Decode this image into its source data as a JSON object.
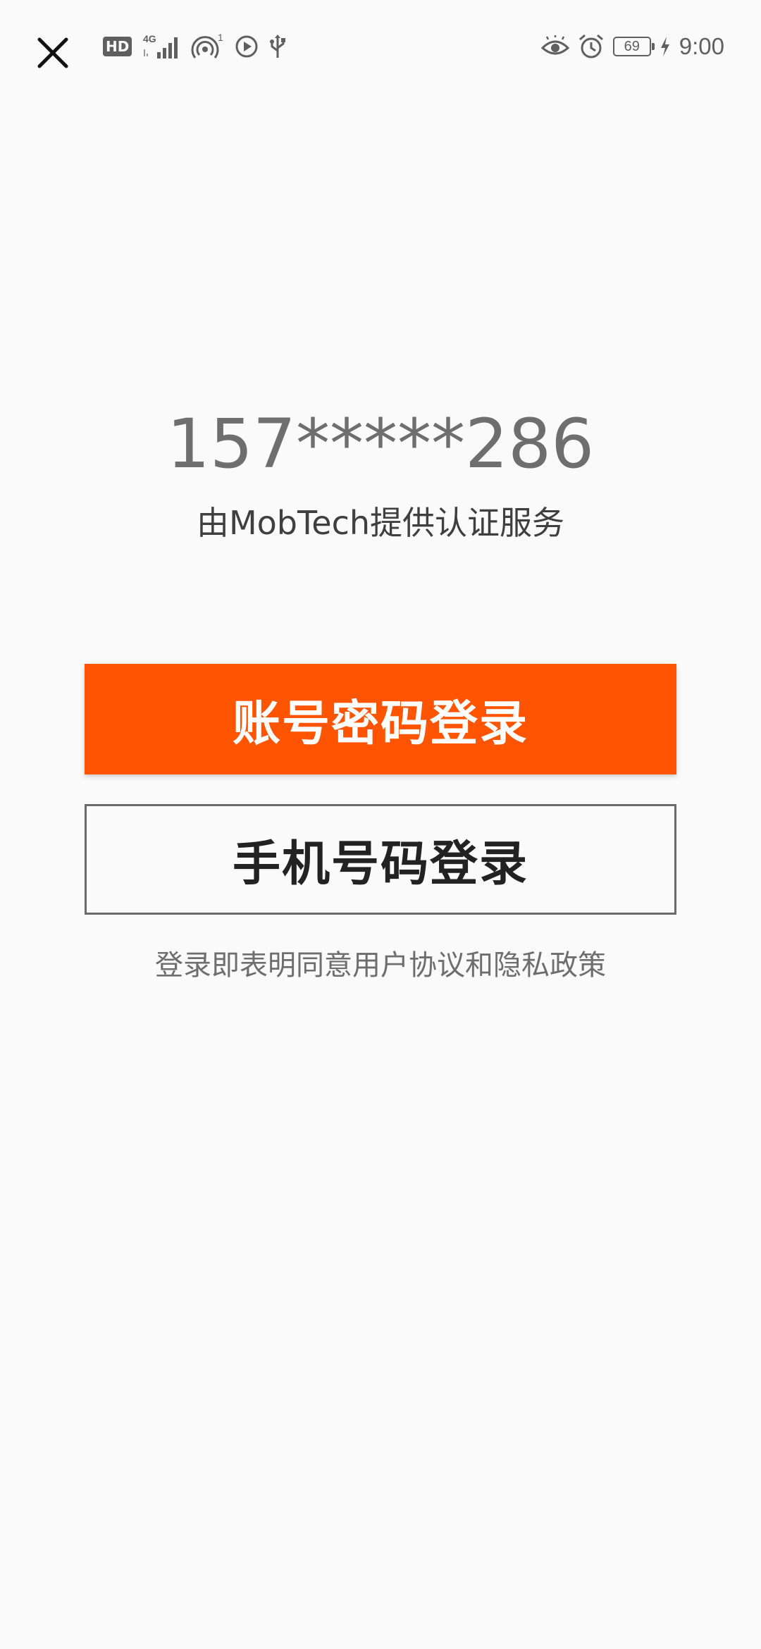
{
  "status_bar": {
    "hd_label": "HD",
    "network_label": "4G",
    "hotspot_count": "1",
    "battery_level": "69",
    "time": "9:00",
    "icon_color": "#5f5f5f"
  },
  "phone": {
    "masked_number": "157*****286",
    "provider_text": "由MobTech提供认证服务"
  },
  "actions": {
    "password_login_label": "账号密码登录",
    "phone_login_label": "手机号码登录"
  },
  "agreement_text": "登录即表明同意用户协议和隐私政策",
  "colors": {
    "accent": "#ff5503",
    "background": "#fafafa",
    "text_primary": "#222222",
    "text_secondary": "#6e6e6e"
  },
  "icons": [
    "close-icon",
    "hd-icon",
    "signal-4g-icon",
    "hotspot-icon",
    "play-icon",
    "usb-icon",
    "eye-icon",
    "alarm-icon",
    "battery-icon",
    "charging-icon"
  ]
}
